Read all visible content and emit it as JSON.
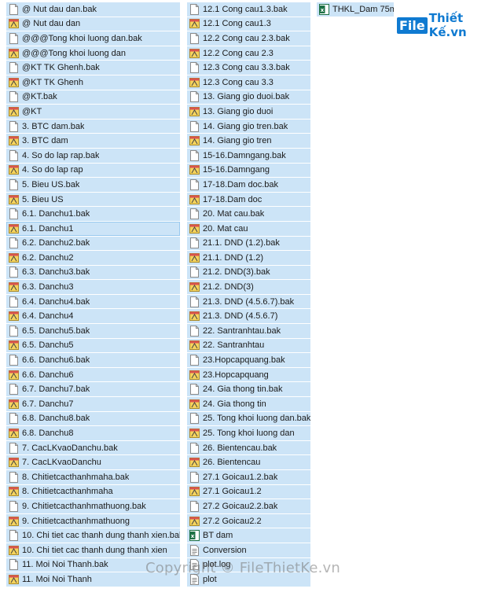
{
  "column1": [
    {
      "label": "@ Nut dau dan.bak",
      "icon": "file-icon"
    },
    {
      "label": "@ Nut dau dan",
      "icon": "autocad-file-icon"
    },
    {
      "label": "@@@Tong khoi luong dan.bak",
      "icon": "file-icon"
    },
    {
      "label": "@@@Tong khoi luong dan",
      "icon": "autocad-file-icon"
    },
    {
      "label": "@KT TK Ghenh.bak",
      "icon": "file-icon"
    },
    {
      "label": "@KT TK Ghenh",
      "icon": "autocad-file-icon"
    },
    {
      "label": "@KT.bak",
      "icon": "file-icon"
    },
    {
      "label": "@KT",
      "icon": "autocad-file-icon"
    },
    {
      "label": "3. BTC dam.bak",
      "icon": "file-icon"
    },
    {
      "label": "3. BTC dam",
      "icon": "autocad-file-icon"
    },
    {
      "label": "4. So do lap rap.bak",
      "icon": "file-icon"
    },
    {
      "label": "4. So do lap rap",
      "icon": "autocad-file-icon"
    },
    {
      "label": "5. Bieu US.bak",
      "icon": "file-icon"
    },
    {
      "label": "5. Bieu US",
      "icon": "autocad-file-icon"
    },
    {
      "label": "6.1. Danchu1.bak",
      "icon": "file-icon"
    },
    {
      "label": "6.1. Danchu1",
      "icon": "autocad-file-icon",
      "selected": true
    },
    {
      "label": "6.2. Danchu2.bak",
      "icon": "file-icon"
    },
    {
      "label": "6.2. Danchu2",
      "icon": "autocad-file-icon"
    },
    {
      "label": "6.3. Danchu3.bak",
      "icon": "file-icon"
    },
    {
      "label": "6.3. Danchu3",
      "icon": "autocad-file-icon"
    },
    {
      "label": "6.4. Danchu4.bak",
      "icon": "file-icon"
    },
    {
      "label": "6.4. Danchu4",
      "icon": "autocad-file-icon"
    },
    {
      "label": "6.5. Danchu5.bak",
      "icon": "file-icon"
    },
    {
      "label": "6.5. Danchu5",
      "icon": "autocad-file-icon"
    },
    {
      "label": "6.6. Danchu6.bak",
      "icon": "file-icon"
    },
    {
      "label": "6.6. Danchu6",
      "icon": "autocad-file-icon"
    },
    {
      "label": "6.7. Danchu7.bak",
      "icon": "file-icon"
    },
    {
      "label": "6.7. Danchu7",
      "icon": "autocad-file-icon"
    },
    {
      "label": "6.8. Danchu8.bak",
      "icon": "file-icon"
    },
    {
      "label": "6.8. Danchu8",
      "icon": "autocad-file-icon"
    },
    {
      "label": "7. CacLKvaoDanchu.bak",
      "icon": "file-icon"
    },
    {
      "label": "7. CacLKvaoDanchu",
      "icon": "autocad-file-icon"
    },
    {
      "label": "8. Chitietcacthanhmaha.bak",
      "icon": "file-icon"
    },
    {
      "label": "8. Chitietcacthanhmaha",
      "icon": "autocad-file-icon"
    },
    {
      "label": "9. Chitietcacthanhmathuong.bak",
      "icon": "file-icon"
    },
    {
      "label": "9. Chitietcacthanhmathuong",
      "icon": "autocad-file-icon"
    },
    {
      "label": "10. Chi tiet cac thanh dung thanh xien.bak",
      "icon": "file-icon"
    },
    {
      "label": "10. Chi tiet cac thanh dung thanh xien",
      "icon": "autocad-file-icon"
    },
    {
      "label": "11. Moi Noi Thanh.bak",
      "icon": "file-icon"
    },
    {
      "label": "11. Moi Noi Thanh",
      "icon": "autocad-file-icon"
    }
  ],
  "column2": [
    {
      "label": "12.1 Cong cau1.3.bak",
      "icon": "file-icon"
    },
    {
      "label": "12.1 Cong cau1.3",
      "icon": "autocad-file-icon"
    },
    {
      "label": "12.2 Cong cau 2.3.bak",
      "icon": "file-icon"
    },
    {
      "label": "12.2 Cong cau 2.3",
      "icon": "autocad-file-icon"
    },
    {
      "label": "12.3 Cong cau 3.3.bak",
      "icon": "file-icon"
    },
    {
      "label": "12.3 Cong cau 3.3",
      "icon": "autocad-file-icon"
    },
    {
      "label": "13. Giang gio duoi.bak",
      "icon": "file-icon"
    },
    {
      "label": "13. Giang gio duoi",
      "icon": "autocad-file-icon"
    },
    {
      "label": "14. Giang gio tren.bak",
      "icon": "file-icon"
    },
    {
      "label": "14. Giang gio tren",
      "icon": "autocad-file-icon"
    },
    {
      "label": "15-16.Damngang.bak",
      "icon": "file-icon"
    },
    {
      "label": "15-16.Damngang",
      "icon": "autocad-file-icon"
    },
    {
      "label": "17-18.Dam doc.bak",
      "icon": "file-icon"
    },
    {
      "label": "17-18.Dam doc",
      "icon": "autocad-file-icon"
    },
    {
      "label": "20. Mat cau.bak",
      "icon": "file-icon"
    },
    {
      "label": "20. Mat cau",
      "icon": "autocad-file-icon"
    },
    {
      "label": "21.1. DND (1.2).bak",
      "icon": "file-icon"
    },
    {
      "label": "21.1. DND (1.2)",
      "icon": "autocad-file-icon"
    },
    {
      "label": "21.2. DND(3).bak",
      "icon": "file-icon"
    },
    {
      "label": "21.2. DND(3)",
      "icon": "autocad-file-icon"
    },
    {
      "label": "21.3. DND (4.5.6.7).bak",
      "icon": "file-icon"
    },
    {
      "label": "21.3. DND (4.5.6.7)",
      "icon": "autocad-file-icon"
    },
    {
      "label": "22. Santranhtau.bak",
      "icon": "file-icon"
    },
    {
      "label": "22. Santranhtau",
      "icon": "autocad-file-icon"
    },
    {
      "label": "23.Hopcapquang.bak",
      "icon": "file-icon"
    },
    {
      "label": "23.Hopcapquang",
      "icon": "autocad-file-icon"
    },
    {
      "label": "24. Gia thong tin.bak",
      "icon": "file-icon"
    },
    {
      "label": "24. Gia thong tin",
      "icon": "autocad-file-icon"
    },
    {
      "label": "25. Tong khoi luong dan.bak",
      "icon": "file-icon"
    },
    {
      "label": "25. Tong khoi luong dan",
      "icon": "autocad-file-icon"
    },
    {
      "label": "26. Bientencau.bak",
      "icon": "file-icon"
    },
    {
      "label": "26. Bientencau",
      "icon": "autocad-file-icon"
    },
    {
      "label": "27.1 Goicau1.2.bak",
      "icon": "file-icon"
    },
    {
      "label": "27.1 Goicau1.2",
      "icon": "autocad-file-icon"
    },
    {
      "label": "27.2 Goicau2.2.bak",
      "icon": "file-icon"
    },
    {
      "label": "27.2 Goicau2.2",
      "icon": "autocad-file-icon"
    },
    {
      "label": "BT dam",
      "icon": "excel-file-icon"
    },
    {
      "label": "Conversion",
      "icon": "text-file-icon"
    },
    {
      "label": "plot.log",
      "icon": "text-file-icon"
    },
    {
      "label": "plot",
      "icon": "text-file-icon"
    }
  ],
  "column3": [
    {
      "label": "THKL_Dam 75m",
      "icon": "excel-file-icon"
    }
  ],
  "logo": {
    "prefix": "File",
    "rest": "Thiết Kế.vn"
  },
  "watermark": "Copyright © FileThietKe.vn",
  "colors": {
    "selection": "#cce4f7",
    "selection_border": "#99c9ef",
    "autocad": "#c9302c",
    "excel": "#1e7145",
    "logo": "#0f7ad1"
  }
}
